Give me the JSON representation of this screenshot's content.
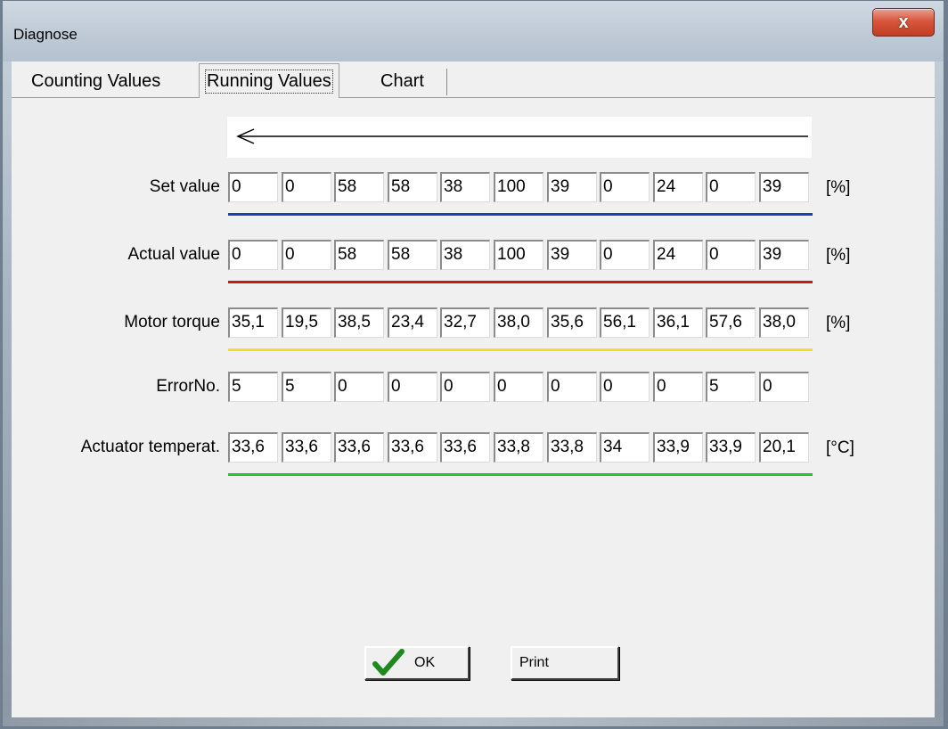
{
  "window": {
    "title": "Diagnose",
    "close_glyph": "x"
  },
  "tabs": [
    {
      "label": "Counting Values"
    },
    {
      "label": "Running Values"
    },
    {
      "label": "Chart"
    }
  ],
  "rows": [
    {
      "label": "Set value",
      "values": [
        "0",
        "0",
        "58",
        "58",
        "38",
        "100",
        "39",
        "0",
        "24",
        "0",
        "39"
      ],
      "unit": "[%]",
      "line_color": "#1f3fb8"
    },
    {
      "label": "Actual value",
      "values": [
        "0",
        "0",
        "58",
        "58",
        "38",
        "100",
        "39",
        "0",
        "24",
        "0",
        "39"
      ],
      "unit": "[%]",
      "line_color": "#c41a1a"
    },
    {
      "label": "Motor torque",
      "values": [
        "35,1",
        "19,5",
        "38,5",
        "23,4",
        "32,7",
        "38,0",
        "35,6",
        "56,1",
        "36,1",
        "57,6",
        "38,0"
      ],
      "unit": "[%]",
      "line_color": "#f0e020"
    },
    {
      "label": "ErrorNo.",
      "values": [
        "5",
        "5",
        "0",
        "0",
        "0",
        "0",
        "0",
        "0",
        "0",
        "5",
        "0"
      ],
      "unit": "",
      "line_color": ""
    },
    {
      "label": "Actuator temperat.",
      "values": [
        "33,6",
        "33,6",
        "33,6",
        "33,6",
        "33,6",
        "33,8",
        "33,8",
        "34",
        "33,9",
        "33,9",
        "20,1"
      ],
      "unit": "[°C]",
      "line_color": "#2ec12e"
    }
  ],
  "buttons": {
    "ok_label": "OK",
    "print_label": "Print"
  },
  "icons": {
    "ok": "checkmark-icon",
    "arrow": "arrow-left-icon",
    "close": "close-icon"
  }
}
